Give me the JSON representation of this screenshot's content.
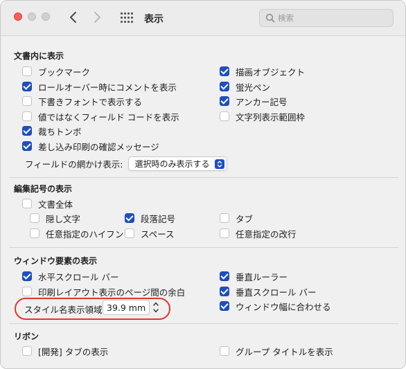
{
  "window": {
    "title": "表示",
    "nav": {
      "back_glyph": "‹",
      "forward_glyph": "›"
    },
    "search": {
      "placeholder": "検索",
      "value": ""
    },
    "icons": [
      "close-light",
      "minimize-light",
      "zoom-light",
      "chevron-left-icon",
      "chevron-right-icon",
      "grid-icon",
      "search-icon"
    ]
  },
  "sections": {
    "document": {
      "title": "文書内に表示",
      "left": [
        {
          "label": "ブックマーク",
          "checked": false
        },
        {
          "label": "ロールオーバー時にコメントを表示",
          "checked": true
        },
        {
          "label": "下書きフォントで表示する",
          "checked": false
        },
        {
          "label": "値ではなくフィールド コードを表示",
          "checked": false
        },
        {
          "label": "裁ちトンボ",
          "checked": true
        },
        {
          "label": "差し込み印刷の確認メッセージ",
          "checked": true
        }
      ],
      "right": [
        {
          "label": "描画オブジェクト",
          "checked": true
        },
        {
          "label": "蛍光ペン",
          "checked": true
        },
        {
          "label": "アンカー記号",
          "checked": true
        },
        {
          "label": "文字列表示範囲枠",
          "checked": false
        }
      ],
      "field_shading": {
        "label": "フィールドの網かけ表示:",
        "value": "選択時のみ表示する"
      }
    },
    "marks": {
      "title": "編集記号の表示",
      "all": {
        "label": "文書全体",
        "checked": false
      },
      "items": [
        {
          "label": "隠し文字",
          "checked": false
        },
        {
          "label": "段落記号",
          "checked": true
        },
        {
          "label": "タブ",
          "checked": false
        },
        {
          "label": "任意指定のハイフン",
          "checked": false
        },
        {
          "label": "スペース",
          "checked": false
        },
        {
          "label": "任意指定の改行",
          "checked": false
        }
      ]
    },
    "window_elements": {
      "title": "ウィンドウ要素の表示",
      "left": [
        {
          "label": "水平スクロール バー",
          "checked": true
        },
        {
          "label": "印刷レイアウト表示のページ間の余白",
          "checked": false
        }
      ],
      "right": [
        {
          "label": "垂直ルーラー",
          "checked": true
        },
        {
          "label": "垂直スクロール バー",
          "checked": true
        },
        {
          "label": "ウィンドウ幅に合わせる",
          "checked": true
        }
      ],
      "style_area": {
        "label": "スタイル名表示領域:",
        "value": "39.9 mm"
      },
      "highlight_color": "#e0362b"
    },
    "ribbon": {
      "title": "リボン",
      "left": {
        "label": "[開発] タブの表示",
        "checked": false
      },
      "right": {
        "label": "グループ タイトルを表示",
        "checked": false
      }
    }
  },
  "colors": {
    "accent": "#1d4fc4",
    "close": "#fe5f57"
  }
}
